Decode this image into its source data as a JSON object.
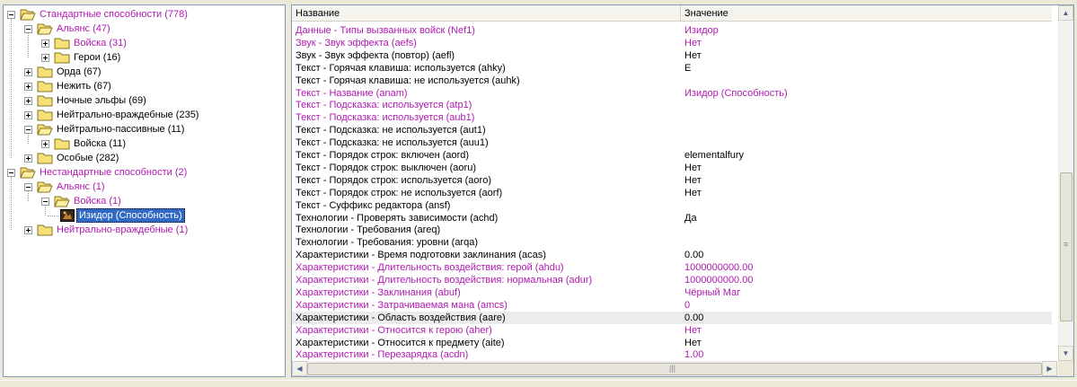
{
  "tree": {
    "items": [
      {
        "label": "Стандартные способности (778)",
        "purple": true
      },
      {
        "label": "Альянс (47)",
        "purple": true
      },
      {
        "label": "Войска (31)",
        "purple": true
      },
      {
        "label": "Герои (16)",
        "purple": false
      },
      {
        "label": "Орда (67)",
        "purple": false
      },
      {
        "label": "Нежить (67)",
        "purple": false
      },
      {
        "label": "Ночные эльфы (69)",
        "purple": false
      },
      {
        "label": "Нейтрально-враждебные (235)",
        "purple": false
      },
      {
        "label": "Нейтрально-пассивные (11)",
        "purple": false
      },
      {
        "label": "Войска (11)",
        "purple": false
      },
      {
        "label": "Особые (282)",
        "purple": false
      },
      {
        "label": "Нестандартные способности (2)",
        "purple": true
      },
      {
        "label": "Альянс (1)",
        "purple": true
      },
      {
        "label": "Войска (1)",
        "purple": true
      },
      {
        "label": "Изидор (Способность)",
        "purple": false,
        "selected": true
      },
      {
        "label": "Нейтрально-враждебные (1)",
        "purple": true
      }
    ]
  },
  "grid": {
    "columns": [
      "Название",
      "Значение"
    ],
    "rows": [
      {
        "name": "Данные - Типы вызванных войск (Nef1)",
        "value": "Изидор",
        "purple": true
      },
      {
        "name": "Звук - Звук эффекта (aefs)",
        "value": "Нет",
        "purple": true
      },
      {
        "name": "Звук - Звук эффекта (повтор) (aefl)",
        "value": "Нет",
        "purple": false
      },
      {
        "name": "Текст - Горячая клавиша: используется (ahky)",
        "value": "E",
        "purple": false
      },
      {
        "name": "Текст - Горячая клавиша: не используется (auhk)",
        "value": "",
        "purple": false
      },
      {
        "name": "Текст - Название (anam)",
        "value": "Изидор (Способность)",
        "purple": true
      },
      {
        "name": "Текст - Подсказка: используется (atp1)",
        "value": "",
        "purple": true
      },
      {
        "name": "Текст - Подсказка: используется (aub1)",
        "value": "",
        "purple": true
      },
      {
        "name": "Текст - Подсказка: не используется (aut1)",
        "value": "",
        "purple": false
      },
      {
        "name": "Текст - Подсказка: не используется (auu1)",
        "value": "",
        "purple": false
      },
      {
        "name": "Текст - Порядок строк: включен (aord)",
        "value": "elementalfury",
        "purple": false
      },
      {
        "name": "Текст - Порядок строк: выключен (aoru)",
        "value": "Нет",
        "purple": false
      },
      {
        "name": "Текст - Порядок строк: используется (aoro)",
        "value": "Нет",
        "purple": false
      },
      {
        "name": "Текст - Порядок строк: не используется (aorf)",
        "value": "Нет",
        "purple": false
      },
      {
        "name": "Текст - Суффикс редактора (ansf)",
        "value": "",
        "purple": false
      },
      {
        "name": "Технологии - Проверять зависимости (achd)",
        "value": "Да",
        "purple": false
      },
      {
        "name": "Технологии - Требования (areq)",
        "value": "",
        "purple": false
      },
      {
        "name": "Технологии - Требования: уровни (arqa)",
        "value": "",
        "purple": false
      },
      {
        "name": "Характеристики - Время подготовки заклинания (acas)",
        "value": "0.00",
        "purple": false
      },
      {
        "name": "Характеристики - Длительность воздействия: герой (ahdu)",
        "value": "1000000000.00",
        "purple": true
      },
      {
        "name": "Характеристики - Длительность воздействия: нормальная (adur)",
        "value": "1000000000.00",
        "purple": true
      },
      {
        "name": "Характеристики - Заклинания (abuf)",
        "value": "Чёрный Маг",
        "purple": true
      },
      {
        "name": "Характеристики - Затрачиваемая мана (amcs)",
        "value": "0",
        "purple": true
      },
      {
        "name": "Характеристики - Область воздействия (aare)",
        "value": "0.00",
        "purple": false,
        "highlight": true
      },
      {
        "name": "Характеристики - Относится к герою (aher)",
        "value": "Нет",
        "purple": true
      },
      {
        "name": "Характеристики - Относится к предмету (aite)",
        "value": "Нет",
        "purple": false
      },
      {
        "name": "Характеристики - Перезарядка (acdn)",
        "value": "1.00",
        "purple": true
      }
    ]
  },
  "icons": {
    "folder": "folder-icon",
    "expand": "expand-icon",
    "collapse": "collapse-icon",
    "ability": "ability-icon"
  },
  "colors": {
    "modified": "#b01ab0",
    "selection": "#316ac5"
  }
}
